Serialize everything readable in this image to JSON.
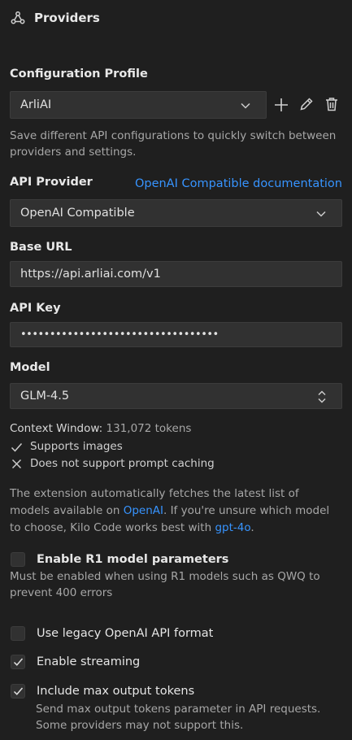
{
  "header": {
    "title": "Providers",
    "icon": "webhook-icon"
  },
  "profile": {
    "label": "Configuration Profile",
    "selected": "ArliAI",
    "help": "Save different API configurations to quickly switch between providers and settings.",
    "actions": [
      "add-icon",
      "edit-icon",
      "delete-icon"
    ]
  },
  "provider": {
    "label": "API Provider",
    "doc_link": "OpenAI Compatible documentation",
    "selected": "OpenAI Compatible"
  },
  "base_url": {
    "label": "Base URL",
    "value": "https://api.arliai.com/v1"
  },
  "api_key": {
    "label": "API Key",
    "value": "••••••••••••••••••••••••••••••••••"
  },
  "model": {
    "label": "Model",
    "selected": "GLM-4.5",
    "context_label": "Context Window:",
    "context_value": "131,072 tokens",
    "supports_images": "Supports images",
    "no_caching": "Does not support prompt caching"
  },
  "info": {
    "part1": "The extension automatically fetches the latest list of models available on ",
    "link1": "OpenAI",
    "part2": ". If you're unsure which model to choose, Kilo Code works best with ",
    "link2": "gpt-4o",
    "part3": "."
  },
  "options": {
    "r1_label": "Enable R1 model parameters",
    "r1_checked": false,
    "r1_help": "Must be enabled when using R1 models such as QWQ to prevent 400 errors",
    "legacy_label": "Use legacy OpenAI API format",
    "legacy_checked": false,
    "streaming_label": "Enable streaming",
    "streaming_checked": true,
    "max_tokens_label": "Include max output tokens",
    "max_tokens_checked": true,
    "max_tokens_help": "Send max output tokens parameter in API requests. Some providers may not support this."
  },
  "colors": {
    "background": "#1f1f1f",
    "input": "#313131",
    "link": "#3794ff",
    "text": "#cccccc"
  }
}
